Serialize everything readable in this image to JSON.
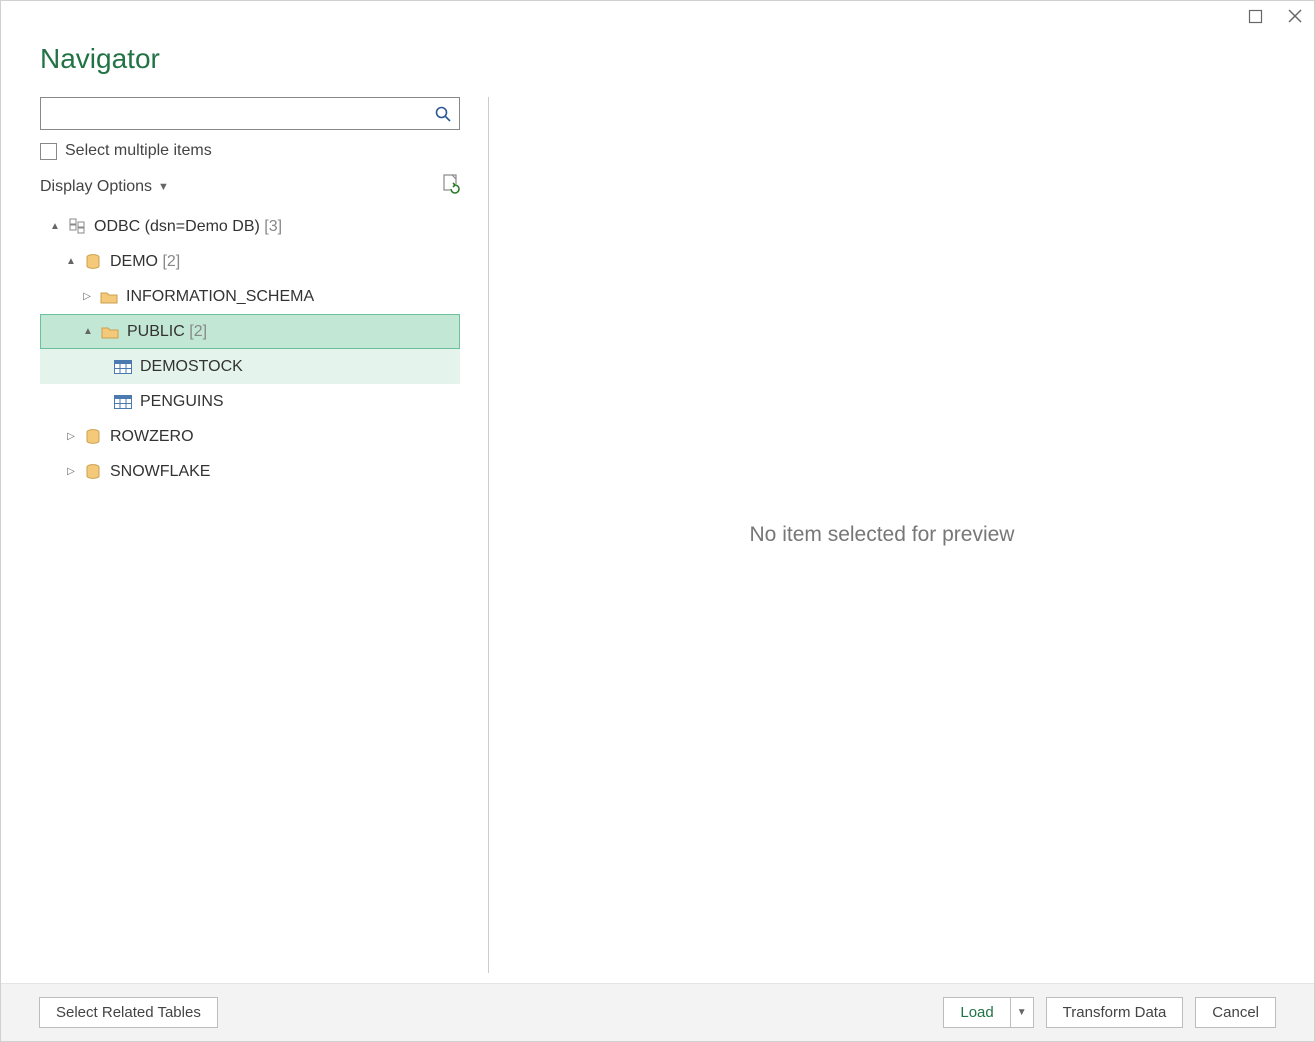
{
  "title": "Navigator",
  "search": {
    "value": ""
  },
  "multi": {
    "label": "Select multiple items",
    "checked": false
  },
  "displayOptions": {
    "label": "Display Options"
  },
  "tree": {
    "root": {
      "label": "ODBC (dsn=Demo DB)",
      "count": "[3]",
      "expanded": true,
      "children": [
        {
          "label": "DEMO",
          "count": "[2]",
          "expanded": true,
          "children": [
            {
              "label": "INFORMATION_SCHEMA",
              "expanded": false,
              "kind": "schema"
            },
            {
              "label": "PUBLIC",
              "count": "[2]",
              "expanded": true,
              "selected": true,
              "kind": "schema",
              "children": [
                {
                  "label": "DEMOSTOCK",
                  "kind": "table",
                  "hover": true
                },
                {
                  "label": "PENGUINS",
                  "kind": "table"
                }
              ]
            }
          ]
        },
        {
          "label": "ROWZERO",
          "expanded": false
        },
        {
          "label": "SNOWFLAKE",
          "expanded": false
        }
      ]
    }
  },
  "preview": {
    "empty": "No item selected for preview"
  },
  "footer": {
    "selectRelated": "Select Related Tables",
    "load": "Load",
    "transform": "Transform Data",
    "cancel": "Cancel"
  }
}
